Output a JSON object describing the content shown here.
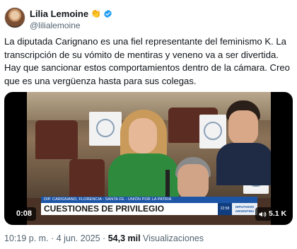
{
  "author": {
    "display_name": "Lilia Lemoine",
    "emoji": "👏",
    "handle": "@lilialemoine"
  },
  "tweet": {
    "text": "La diputada Carignano es una fiel representante del feminismo K. La transcripción de su vómito de mentiras y veneno va a ser divertida. Hay que sancionar estos comportamientos dentro de la cámara. Creo que es una vergüenza hasta para sus colegas."
  },
  "video": {
    "lower_third_top": "DIP. CARIGNANO, FLORENCIA - SANTA FE - UNIÓN POR LA PATRIA",
    "lower_third_main": "CUESTIONES DE PRIVILEGIO",
    "lower_third_clock": "22:58",
    "lower_third_logo": "DIPUTADOS ARGENTINA",
    "duration": "0:08",
    "view_count": "5.1 K"
  },
  "meta": {
    "time": "10:19 p. m.",
    "separator": "·",
    "date": "4 jun. 2025",
    "views_value": "54,3 mil",
    "views_label": "Visualizaciones"
  },
  "colors": {
    "verified": "#1d9bf0",
    "secondary_text": "#536471",
    "lower_third_blue": "#1d55a6"
  },
  "icons": [
    "verified-badge-icon",
    "clapping-hands-emoji-icon",
    "sound-icon"
  ]
}
